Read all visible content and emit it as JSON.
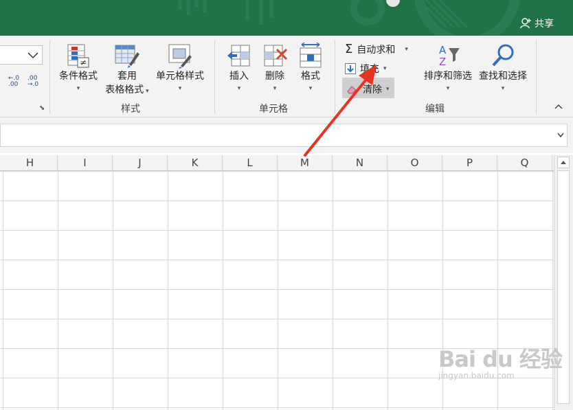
{
  "titlebar": {
    "share_label": "共享"
  },
  "ribbon": {
    "number_format": {
      "increase_decimal": "←.0\n.00",
      "decrease_decimal": ".00\n→.0"
    },
    "styles": {
      "conditional_format": "条件格式",
      "format_as_table_line1": "套用",
      "format_as_table_line2": "表格格式",
      "cell_styles": "单元格样式",
      "group_label": "样式"
    },
    "cells": {
      "insert": "插入",
      "delete": "删除",
      "format": "格式",
      "group_label": "单元格"
    },
    "editing": {
      "autosum": "自动求和",
      "fill": "填充",
      "clear": "清除",
      "sort_filter": "排序和筛选",
      "find_select": "查找和选择",
      "group_label": "编辑"
    }
  },
  "columns": [
    "H",
    "I",
    "J",
    "K",
    "L",
    "M",
    "N",
    "O",
    "P",
    "Q"
  ],
  "watermark": {
    "brand": "Bai du 经验",
    "url": "jingyan.baidu.com"
  },
  "colors": {
    "excel_green": "#217346",
    "arrow_red": "#e8331f"
  }
}
